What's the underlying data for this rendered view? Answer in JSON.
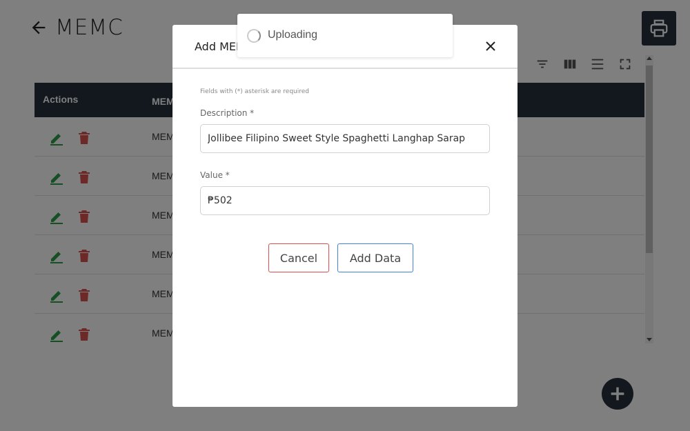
{
  "page": {
    "title": "MEMC"
  },
  "table": {
    "headers": [
      "Actions",
      "MEMC"
    ],
    "rows": [
      {
        "text": "MEMC"
      },
      {
        "text": "MEMC"
      },
      {
        "text": "MEMC"
      },
      {
        "text": "MEMC"
      },
      {
        "text": "MEMC"
      },
      {
        "text": "MEMC"
      }
    ]
  },
  "toast": {
    "message": "Uploading"
  },
  "modal": {
    "title": "Add MEMC",
    "close_label": "X",
    "required_note": "Fields with (*) asterisk are required",
    "description_label": "Description *",
    "description_value": "Jollibee Filipino Sweet Style Spaghetti Langhap Sarap",
    "value_label": "Value *",
    "value_value": "₱502",
    "cancel_label": "Cancel",
    "add_label": "Add Data"
  },
  "colors": {
    "header_dark": "#24303d",
    "cancel_border": "#e04b4b",
    "add_border": "#3b82e0",
    "edit_icon": "#2e9e4a",
    "delete_icon": "#d9534f"
  }
}
